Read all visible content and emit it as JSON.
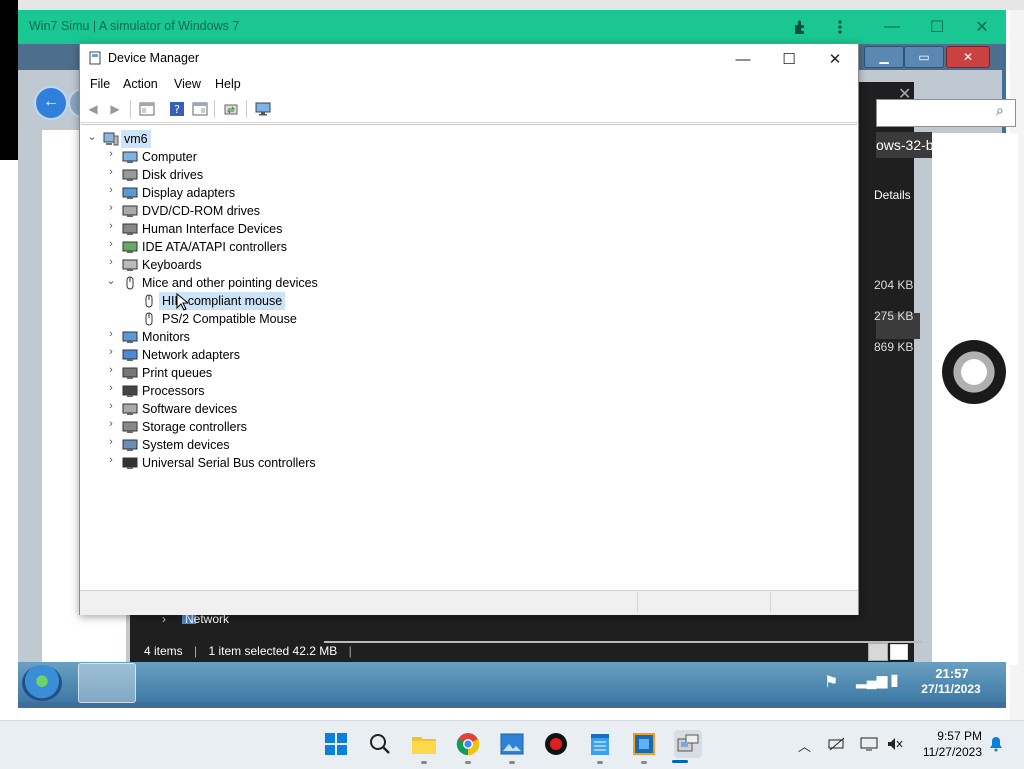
{
  "host": {
    "app_title": "Win7 Simu | A simulator of Windows 7"
  },
  "explorer": {
    "tab_text": "ows-32-b",
    "details_label": "Details",
    "sizes": [
      "204 KB",
      "275 KB",
      "869 KB"
    ],
    "nav_network": "Network",
    "status_items": "4 items",
    "status_selected": "1 item selected  42.2 MB"
  },
  "device_manager": {
    "title": "Device Manager",
    "menu": [
      "File",
      "Action",
      "View",
      "Help"
    ],
    "root": "vm6",
    "categories": [
      "Computer",
      "Disk drives",
      "Display adapters",
      "DVD/CD-ROM drives",
      "Human Interface Devices",
      "IDE ATA/ATAPI controllers",
      "Keyboards",
      "Mice and other pointing devices",
      "Monitors",
      "Network adapters",
      "Print queues",
      "Processors",
      "Software devices",
      "Storage controllers",
      "System devices",
      "Universal Serial Bus controllers"
    ],
    "mice_children": [
      "HID-compliant mouse",
      "PS/2 Compatible Mouse"
    ],
    "expanded_category": "Mice and other pointing devices",
    "selected_device": "HID-compliant mouse"
  },
  "win7_taskbar": {
    "time": "21:57",
    "date": "27/11/2023"
  },
  "win11_taskbar": {
    "time": "9:57 PM",
    "date": "11/27/2023",
    "apps": [
      "start-icon",
      "search-icon",
      "file-explorer-icon",
      "chrome-icon",
      "photos-icon",
      "record-icon",
      "notepad-icon",
      "virtualbox-icon",
      "device-manager-icon"
    ]
  },
  "colors": {
    "simu_titlebar": "#1ac792",
    "selection": "#cce4f7",
    "win11_accent": "#0067c0"
  }
}
